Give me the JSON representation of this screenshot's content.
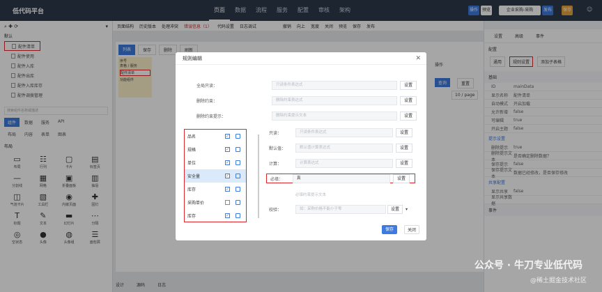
{
  "app": {
    "title": "低代码平台"
  },
  "nav": [
    "页面",
    "数据",
    "流程",
    "服务",
    "配置",
    "审核",
    "架构"
  ],
  "topbar": {
    "btn1": "操作",
    "btn2": "预览",
    "app_select": "企业采购-采购",
    "btn3": "发布",
    "btn4": "保存"
  },
  "left": {
    "section": "默认",
    "pages": [
      "配件清单",
      "配件使用",
      "配件入库",
      "配件出库",
      "配件入库库存",
      "配件调拨管理"
    ],
    "search_placeholder": "搜索组件名称或描述",
    "tabs": [
      "组件",
      "数据",
      "服务",
      "API"
    ],
    "subtabs": [
      "布局",
      "内容",
      "表单",
      "图表"
    ],
    "layout_title": "布局",
    "components": [
      {
        "icon": "▭",
        "label": "布局"
      },
      {
        "icon": "☷",
        "label": "行列"
      },
      {
        "icon": "▢",
        "label": "卡片"
      },
      {
        "icon": "▤",
        "label": "标签页"
      },
      {
        "icon": "—",
        "label": "分割线"
      },
      {
        "icon": "▦",
        "label": "网格"
      },
      {
        "icon": "▣",
        "label": "折叠面板"
      },
      {
        "icon": "▥",
        "label": "抽屉"
      },
      {
        "icon": "◫",
        "label": "气泡卡片"
      },
      {
        "icon": "▧",
        "label": "工具栏"
      },
      {
        "icon": "◉",
        "label": "内嵌页面"
      },
      {
        "icon": "✚",
        "label": "固钉"
      },
      {
        "icon": "T",
        "label": "标题"
      },
      {
        "icon": "✎",
        "label": "文本"
      },
      {
        "icon": "▬",
        "label": "幻灯片"
      },
      {
        "icon": "⋯",
        "label": "分隔"
      },
      {
        "icon": "◎",
        "label": "空状态"
      },
      {
        "icon": "●",
        "label": "头像"
      },
      {
        "icon": "◍",
        "label": "头像组"
      },
      {
        "icon": "☰",
        "label": "面包屑"
      }
    ]
  },
  "center": {
    "toolbar": [
      "页面结构",
      "历史版本",
      "处理冲突",
      "错误信息（1）",
      "代码设置",
      "日志调试"
    ],
    "toolbar_right": [
      "撤销",
      "向上",
      "宽度",
      "关闭",
      "预览",
      "保存",
      "发布"
    ],
    "tab_list": "列表",
    "actions": [
      "保存",
      "删除",
      "刷新"
    ],
    "col_no": "序号",
    "col_op": "操作",
    "row1": "表格 / 服务",
    "row2": "配件清单",
    "row3": "功能组件",
    "btn_query": "查询",
    "btn_reset": "重置",
    "pager": "10 / page",
    "bottom_tabs": [
      "设计",
      "源码",
      "日志"
    ]
  },
  "right": {
    "tabs": [
      "设置",
      "高级",
      "事件"
    ],
    "section": "配置",
    "subtabs": [
      "通用",
      "规则设置",
      "添加子表格"
    ],
    "basic": "基础",
    "props": [
      {
        "k": "ID",
        "v": "mainData"
      },
      {
        "k": "显示名称",
        "v": "配件清单"
      },
      {
        "k": "自动模式",
        "v": "开启加载"
      },
      {
        "k": "允许新增",
        "v": "false"
      },
      {
        "k": "可编辑",
        "v": "true"
      },
      {
        "k": "开启主题",
        "v": "false"
      }
    ],
    "section2": "提示设置",
    "props2": [
      {
        "k": "删除提示",
        "v": "true"
      },
      {
        "k": "删除提示文本",
        "v": "是否确定删除数据？"
      },
      {
        "k": "保存提示",
        "v": "false"
      },
      {
        "k": "保存提示文本",
        "v": "数据已经修改，是否保存修改"
      }
    ],
    "section3": "共享配置",
    "props3": [
      {
        "k": "显示共享",
        "v": "false"
      },
      {
        "k": "显示共享数据",
        "v": ""
      }
    ],
    "section4": "事件"
  },
  "dialog": {
    "title": "规则编辑",
    "rows": [
      {
        "label": "全局只读：",
        "placeholder": "只读条件表达式",
        "btn": "设置"
      },
      {
        "label": "删除约束：",
        "placeholder": "删除约束表达式",
        "btn": "设置"
      },
      {
        "label": "删除约束提示：",
        "placeholder": "删除约束提示文本",
        "btn": "设置"
      }
    ],
    "fields": [
      {
        "name": "品名",
        "checked": true
      },
      {
        "name": "规格",
        "checked": true
      },
      {
        "name": "单位",
        "checked": true
      },
      {
        "name": "安全量",
        "checked": true
      },
      {
        "name": "库存",
        "checked": true
      },
      {
        "name": "采购单价",
        "checked": false
      },
      {
        "name": "库存",
        "checked": true
      }
    ],
    "rules": [
      {
        "label": "只读：",
        "placeholder": "只读条件表达式",
        "btn": "设置"
      },
      {
        "label": "默认值：",
        "placeholder": "默认值计算表达式",
        "btn": "设置"
      },
      {
        "label": "计算：",
        "placeholder": "计算表达式",
        "btn": "设置"
      }
    ],
    "required": {
      "label": "必填：",
      "value": "真",
      "btn": "设置"
    },
    "required_hint": "必填约束提示文本",
    "check": {
      "label": "校验：",
      "placeholder": "如：采购价格不能小于零",
      "btn": "设置"
    },
    "save": "保存",
    "close": "关闭"
  },
  "watermark": {
    "line1": "公众号 · 牛刀专业低代码",
    "line2": "@稀土掘金技术社区"
  },
  "colors": {
    "primary": "#3d7be0",
    "highlight": "#e0242a",
    "topbar": "#2d3a4b"
  }
}
